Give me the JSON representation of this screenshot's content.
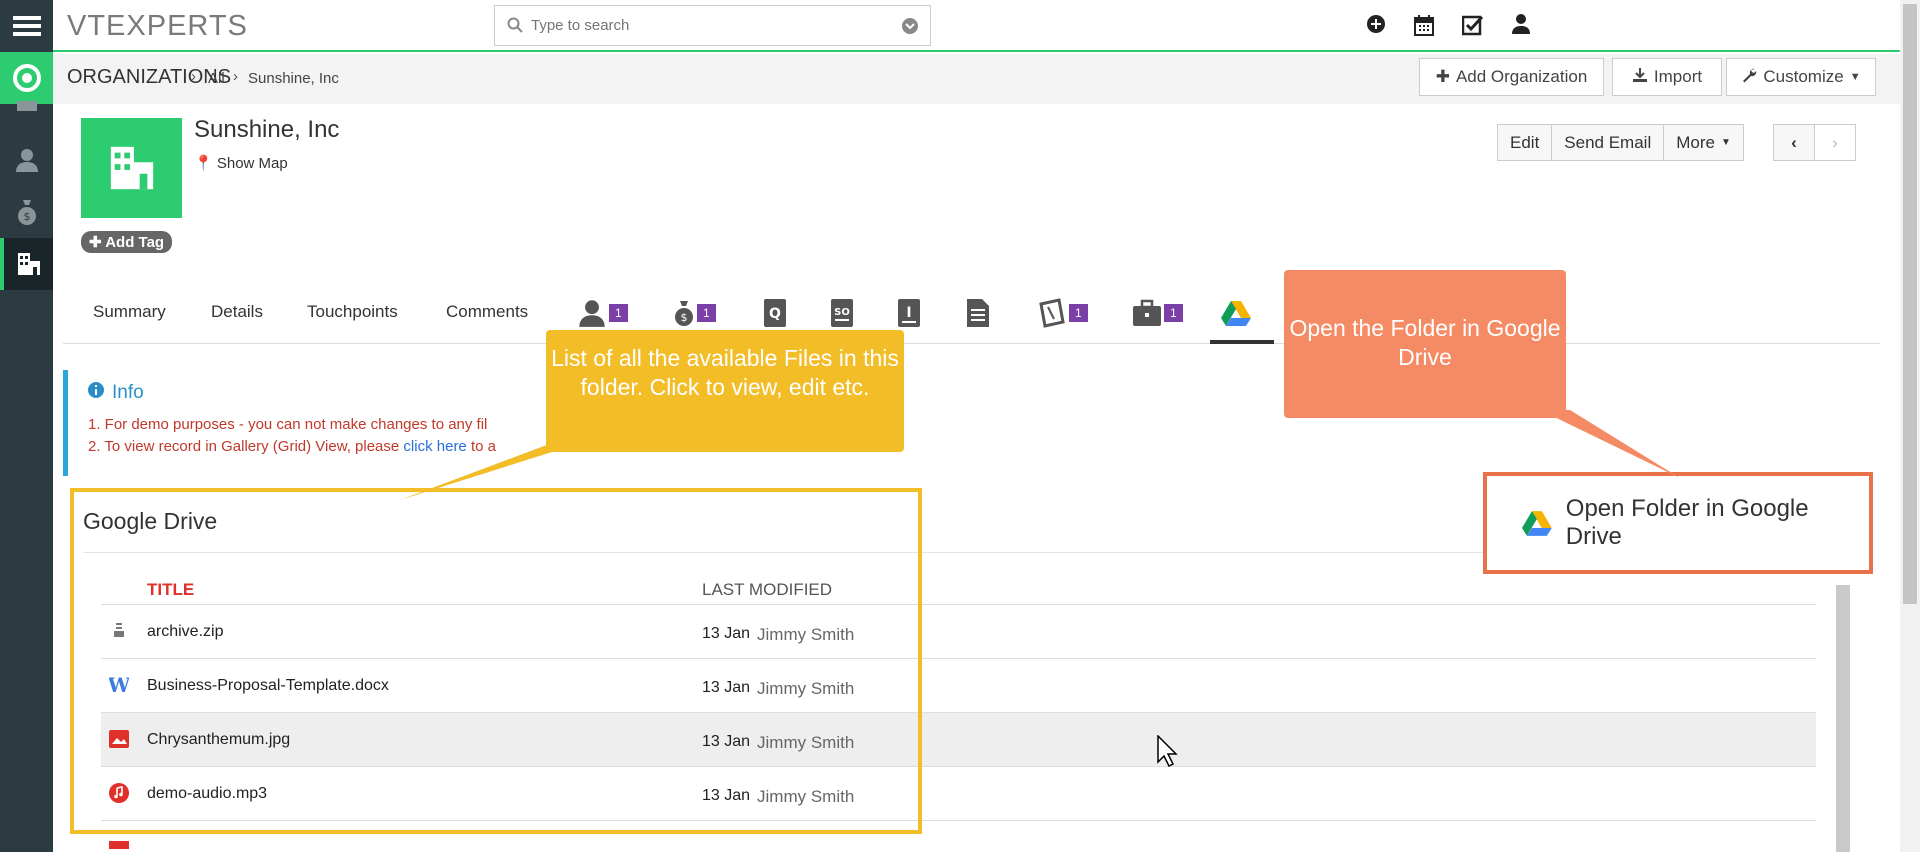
{
  "app": {
    "logo": "VTEXPERTS",
    "search_placeholder": "Type to search"
  },
  "breadcrumb": {
    "module": "ORGANIZATIONS",
    "filter": "All",
    "record": "Sunshine, Inc"
  },
  "header_buttons": {
    "add_org": "Add Organization",
    "import": "Import",
    "customize": "Customize"
  },
  "record": {
    "name": "Sunshine, Inc",
    "show_map": "Show Map",
    "add_tag": "Add Tag",
    "actions": {
      "edit": "Edit",
      "send_email": "Send Email",
      "more": "More"
    }
  },
  "tabs": {
    "summary": "Summary",
    "details": "Details",
    "touchpoints": "Touchpoints",
    "comments": "Comments",
    "badges": [
      "1",
      "1",
      "1",
      "1"
    ]
  },
  "info": {
    "title": "Info",
    "line1": "1. For demo purposes - you can not make changes to any fil",
    "line2_prefix": "2. To view record in Gallery (Grid) View, please ",
    "line2_link": "click here",
    "line2_suffix": " to a"
  },
  "gdrive": {
    "title": "Google Drive",
    "open_folder": "Open Folder in Google Drive",
    "columns": {
      "title": "TITLE",
      "modified": "LAST MODIFIED"
    },
    "files": [
      {
        "name": "archive.zip",
        "date": "13 Jan",
        "user": "Jimmy Smith",
        "icon": "zip-icon"
      },
      {
        "name": "Business-Proposal-Template.docx",
        "date": "13 Jan",
        "user": "Jimmy Smith",
        "icon": "word-icon"
      },
      {
        "name": "Chrysanthemum.jpg",
        "date": "13 Jan",
        "user": "Jimmy Smith",
        "icon": "image-icon"
      },
      {
        "name": "demo-audio.mp3",
        "date": "13 Jan",
        "user": "Jimmy Smith",
        "icon": "audio-icon"
      }
    ]
  },
  "annotations": {
    "yellow": "List of all the available Files in this folder. Click to view, edit etc.",
    "orange": "Open the Folder in Google Drive"
  },
  "colors": {
    "accent_green": "#2ecc71",
    "sidebar": "#2c3b41",
    "badge_purple": "#7b3fa8",
    "annotation_yellow": "#f3bd28",
    "annotation_orange": "#f58b64"
  }
}
